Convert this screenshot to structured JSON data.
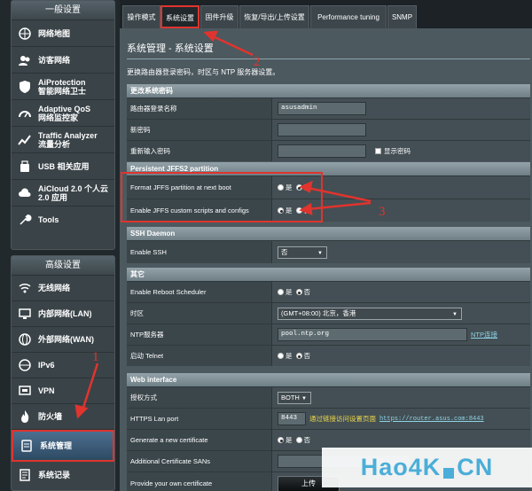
{
  "tabs": [
    "操作模式",
    "系统设置",
    "固件升级",
    "恢复/导出/上传设置",
    "Performance tuning",
    "SNMP"
  ],
  "page": {
    "title": "系统管理 - 系统设置",
    "description": "更换路由器登录密码，时区与 NTP 服务器设置。"
  },
  "sidebar": {
    "general_heading": "一般设置",
    "general_items": [
      {
        "icon": "network-map-icon",
        "label": "网络地图"
      },
      {
        "icon": "guest-network-icon",
        "label": "访客网络"
      },
      {
        "icon": "aiprotection-icon",
        "label": "AiProtection",
        "sub": "智能网络卫士"
      },
      {
        "icon": "adaptive-qos-icon",
        "label": "Adaptive QoS",
        "sub": "网络监控家"
      },
      {
        "icon": "traffic-analyzer-icon",
        "label": "Traffic Analyzer",
        "sub": "流量分析"
      },
      {
        "icon": "usb-icon",
        "label": "USB 相关应用"
      },
      {
        "icon": "aicloud-icon",
        "label": "AiCloud 2.0 个人云",
        "sub": "2.0 应用"
      },
      {
        "icon": "tools-icon",
        "label": "Tools"
      }
    ],
    "advanced_heading": "高级设置",
    "advanced_items": [
      {
        "icon": "wireless-icon",
        "label": "无线网络"
      },
      {
        "icon": "lan-icon",
        "label": "内部网络(LAN)"
      },
      {
        "icon": "wan-icon",
        "label": "外部网络(WAN)"
      },
      {
        "icon": "ipv6-icon",
        "label": "IPv6"
      },
      {
        "icon": "vpn-icon",
        "label": "VPN"
      },
      {
        "icon": "firewall-icon",
        "label": "防火墙"
      },
      {
        "icon": "administration-icon",
        "label": "系统管理"
      },
      {
        "icon": "system-log-icon",
        "label": "系统记录"
      }
    ]
  },
  "sections": {
    "password": {
      "heading": "更改系统密码",
      "login_name_label": "路由器登录名称",
      "login_name_value": "asusadmin",
      "new_password_label": "新密码",
      "retype_label": "重新输入密码",
      "show_password_label": "显示密码"
    },
    "jffs": {
      "heading": "Persistent JFFS2 partition",
      "format_label": "Format JFFS partition at next boot",
      "format_yes": "是",
      "format_no": "否",
      "format_selected": "否",
      "scripts_label": "Enable JFFS custom scripts and configs",
      "scripts_yes": "是",
      "scripts_no": "否",
      "scripts_selected": "是"
    },
    "ssh": {
      "heading": "SSH Daemon",
      "enable_label": "Enable SSH",
      "enable_value": "否"
    },
    "misc": {
      "heading": "其它",
      "reboot_label": "Enable Reboot Scheduler",
      "reboot_yes": "是",
      "reboot_no": "否",
      "timezone_label": "时区",
      "timezone_value": "(GMT+08:00) 北京，香港",
      "ntp_label": "NTP服务器",
      "ntp_value": "pool.ntp.org",
      "ntp_link": "NTP连接",
      "telnet_label": "启动 Telnet",
      "telnet_yes": "是",
      "telnet_no": "否"
    },
    "web": {
      "heading": "Web interface",
      "auth_label": "授权方式",
      "auth_value": "BOTH",
      "https_label": "HTTPS Lan port",
      "https_value": "8443",
      "https_hint": "通过链接访问设置页面",
      "https_link": "https://router.asus.com:8443",
      "cert_label": "Generate a new certificate",
      "cert_yes": "是",
      "cert_no": "否",
      "sans_label": "Additional Certificate SANs",
      "own_cert_label": "Provide your own certificate",
      "upload_label": "上传"
    }
  },
  "annotations": [
    "1",
    "2",
    "3"
  ],
  "watermark": {
    "left": "Hao4K",
    "right": "CN"
  }
}
